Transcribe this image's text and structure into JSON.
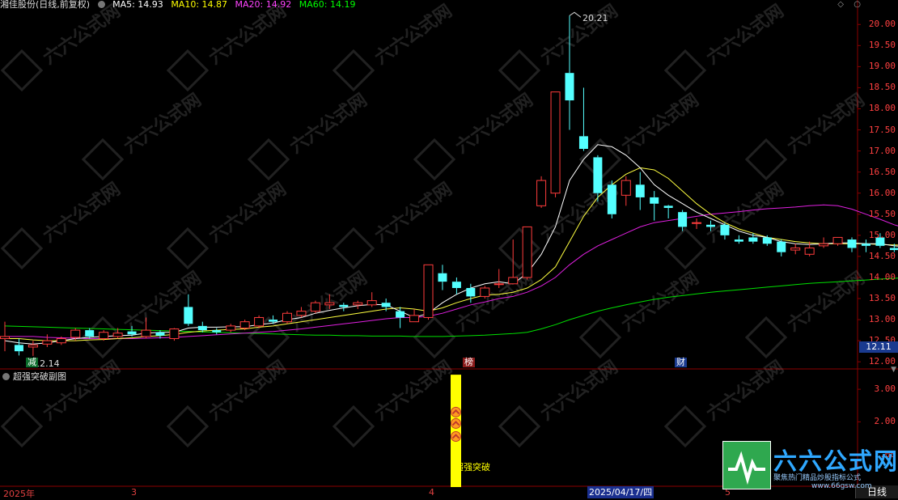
{
  "header": {
    "stock_name": "湘佳股份(日线,前复权)",
    "ma_items": [
      {
        "label": "MA5: 14.93",
        "color": "#ffffff"
      },
      {
        "label": "MA10: 14.87",
        "color": "#ffff00"
      },
      {
        "label": "MA20: 14.92",
        "color": "#ff00ff"
      },
      {
        "label": "MA60: 14.19",
        "color": "#00ff00"
      }
    ]
  },
  "colors": {
    "up": "#ff3c3c",
    "down": "#54ffff",
    "grid": "#8b0000",
    "axis_text": "#ff4040"
  },
  "price_axis": {
    "ticks": [
      "20.00",
      "19.50",
      "19.00",
      "18.50",
      "18.00",
      "17.50",
      "17.00",
      "16.50",
      "16.00",
      "15.50",
      "15.00",
      "14.50",
      "14.00",
      "13.50",
      "13.00",
      "12.50",
      "12.00"
    ]
  },
  "sub_axis": {
    "ticks": [
      "3.00",
      "2.00",
      "1.00"
    ]
  },
  "annotations": {
    "high_label": "20.21",
    "low_label": "12.14",
    "current_price": "12.11",
    "mark_jian": "减",
    "mark_bang": "榜",
    "mark_cai": "财",
    "breakout_label": "超强突破"
  },
  "sub_panel": {
    "title": "超强突破副图"
  },
  "x_axis": {
    "labels": [
      "2025年",
      "3",
      "4",
      "5"
    ],
    "cursor_date": "2025/04/17/四",
    "period": "日线"
  },
  "watermark": {
    "brand": "六六公式网",
    "slogan": "聚焦热门精品炒股指标公式",
    "url": "www.66gsw.com"
  },
  "chart_data": {
    "type": "candlestick",
    "price_range": [
      11.85,
      20.35
    ],
    "candles": [
      [
        12.55,
        12.95,
        12.6,
        12.25
      ],
      [
        12.4,
        12.55,
        12.25,
        12.15
      ],
      [
        12.35,
        12.5,
        12.4,
        12.14
      ],
      [
        12.42,
        12.65,
        12.5,
        12.35
      ],
      [
        12.45,
        12.6,
        12.55,
        12.4
      ],
      [
        12.58,
        12.8,
        12.75,
        12.5
      ],
      [
        12.75,
        12.8,
        12.6,
        12.55
      ],
      [
        12.55,
        12.75,
        12.7,
        12.5
      ],
      [
        12.6,
        12.8,
        12.68,
        12.55
      ],
      [
        12.72,
        12.85,
        12.65,
        12.6
      ],
      [
        12.6,
        13.05,
        12.75,
        12.55
      ],
      [
        12.7,
        12.75,
        12.62,
        12.55
      ],
      [
        12.55,
        12.8,
        12.78,
        12.5
      ],
      [
        13.3,
        13.6,
        12.9,
        12.85
      ],
      [
        12.85,
        12.95,
        12.75,
        12.7
      ],
      [
        12.75,
        12.8,
        12.7,
        12.65
      ],
      [
        12.75,
        12.9,
        12.85,
        12.7
      ],
      [
        12.8,
        13.0,
        12.95,
        12.75
      ],
      [
        12.85,
        13.1,
        13.05,
        12.8
      ],
      [
        13.0,
        13.1,
        12.95,
        12.9
      ],
      [
        12.95,
        13.2,
        13.15,
        12.9
      ],
      [
        13.1,
        13.3,
        13.2,
        13.05
      ],
      [
        13.2,
        13.45,
        13.4,
        13.15
      ],
      [
        13.35,
        13.6,
        13.4,
        13.25
      ],
      [
        13.35,
        13.4,
        13.3,
        13.2
      ],
      [
        13.35,
        13.45,
        13.4,
        13.25
      ],
      [
        13.35,
        13.65,
        13.45,
        13.3
      ],
      [
        13.4,
        13.5,
        13.3,
        13.2
      ],
      [
        13.2,
        13.3,
        13.05,
        12.8
      ],
      [
        12.95,
        13.25,
        13.1,
        12.95
      ],
      [
        13.05,
        14.3,
        14.3,
        13.0
      ],
      [
        14.1,
        14.3,
        13.9,
        13.7
      ],
      [
        13.9,
        14.0,
        13.75,
        13.6
      ],
      [
        13.75,
        13.85,
        13.55,
        13.4
      ],
      [
        13.55,
        13.8,
        13.75,
        13.5
      ],
      [
        13.85,
        14.2,
        13.85,
        13.75
      ],
      [
        13.85,
        14.9,
        14.0,
        13.85
      ],
      [
        14.0,
        15.2,
        15.2,
        13.95
      ],
      [
        15.7,
        16.4,
        16.3,
        15.65
      ],
      [
        16.0,
        18.4,
        18.4,
        15.9
      ],
      [
        18.85,
        20.21,
        18.2,
        17.5
      ],
      [
        17.35,
        18.5,
        17.05,
        17.0
      ],
      [
        16.85,
        16.9,
        16.0,
        15.8
      ],
      [
        16.2,
        16.3,
        15.5,
        15.4
      ],
      [
        15.95,
        16.4,
        16.3,
        15.7
      ],
      [
        16.2,
        16.5,
        15.9,
        15.6
      ],
      [
        15.9,
        16.05,
        15.75,
        15.35
      ],
      [
        15.7,
        15.72,
        15.65,
        15.4
      ],
      [
        15.55,
        15.6,
        15.2,
        15.1
      ],
      [
        15.3,
        15.4,
        15.3,
        15.15
      ],
      [
        15.25,
        15.35,
        15.2,
        15.1
      ],
      [
        15.25,
        15.3,
        15.0,
        14.9
      ],
      [
        14.9,
        15.0,
        14.85,
        14.8
      ],
      [
        14.95,
        15.05,
        14.85,
        14.8
      ],
      [
        14.95,
        15.0,
        14.8,
        14.75
      ],
      [
        14.85,
        14.9,
        14.6,
        14.5
      ],
      [
        14.65,
        14.8,
        14.7,
        14.55
      ],
      [
        14.55,
        14.85,
        14.7,
        14.5
      ],
      [
        14.75,
        14.95,
        14.8,
        14.7
      ],
      [
        14.8,
        14.95,
        14.95,
        14.75
      ],
      [
        14.9,
        14.95,
        14.7,
        14.6
      ],
      [
        14.8,
        14.9,
        14.75,
        14.6
      ],
      [
        14.95,
        15.05,
        14.75,
        14.7
      ],
      [
        14.7,
        14.8,
        14.65,
        14.6
      ],
      [
        14.62,
        14.68,
        14.55,
        14.5
      ],
      [
        14.55,
        14.65,
        14.6,
        14.45
      ],
      [
        14.65,
        14.72,
        14.65,
        14.6
      ],
      [
        14.7,
        15.3,
        15.0,
        14.75
      ],
      [
        15.05,
        15.55,
        15.25,
        14.6
      ],
      [
        14.85,
        14.9,
        14.7,
        14.65
      ],
      [
        15.0,
        16.0,
        15.5,
        15.0
      ]
    ],
    "ma5": [
      12.5,
      12.45,
      12.42,
      12.45,
      12.5,
      12.55,
      12.58,
      12.6,
      12.62,
      12.63,
      12.68,
      12.7,
      12.7,
      12.8,
      12.82,
      12.82,
      12.83,
      12.83,
      12.88,
      12.92,
      13.0,
      13.05,
      13.15,
      13.22,
      13.28,
      13.33,
      13.36,
      13.35,
      13.2,
      13.05,
      13.15,
      13.4,
      13.6,
      13.75,
      13.85,
      13.9,
      13.85,
      14.1,
      14.55,
      15.2,
      16.3,
      16.8,
      17.15,
      17.1,
      16.9,
      16.6,
      16.2,
      15.95,
      15.75,
      15.55,
      15.4,
      15.25,
      15.1,
      15.0,
      14.95,
      14.85,
      14.8,
      14.78,
      14.8,
      14.82,
      14.82,
      14.8,
      14.8,
      14.75,
      14.72,
      14.7,
      14.7,
      14.75,
      14.8,
      14.85,
      14.93
    ],
    "ma10": [
      12.55,
      12.55,
      12.52,
      12.5,
      12.5,
      12.5,
      12.52,
      12.53,
      12.55,
      12.57,
      12.6,
      12.62,
      12.65,
      12.7,
      12.73,
      12.75,
      12.77,
      12.78,
      12.82,
      12.85,
      12.9,
      12.95,
      13.0,
      13.05,
      13.1,
      13.15,
      13.2,
      13.25,
      13.28,
      13.25,
      13.2,
      13.28,
      13.4,
      13.5,
      13.58,
      13.6,
      13.65,
      13.75,
      13.95,
      14.25,
      14.85,
      15.45,
      15.9,
      16.2,
      16.45,
      16.6,
      16.55,
      16.35,
      16.05,
      15.75,
      15.5,
      15.3,
      15.15,
      15.05,
      14.95,
      14.9,
      14.85,
      14.82,
      14.8,
      14.8,
      14.8,
      14.8,
      14.78,
      14.77,
      14.76,
      14.75,
      14.74,
      14.74,
      14.76,
      14.8,
      14.87
    ],
    "ma20": [
      12.6,
      12.6,
      12.6,
      12.58,
      12.57,
      12.56,
      12.55,
      12.55,
      12.55,
      12.55,
      12.56,
      12.57,
      12.58,
      12.6,
      12.62,
      12.64,
      12.66,
      12.68,
      12.7,
      12.72,
      12.75,
      12.78,
      12.82,
      12.86,
      12.9,
      12.94,
      12.98,
      13.02,
      13.05,
      13.05,
      13.08,
      13.15,
      13.25,
      13.35,
      13.42,
      13.5,
      13.55,
      13.65,
      13.8,
      14.0,
      14.3,
      14.55,
      14.75,
      14.9,
      15.05,
      15.2,
      15.3,
      15.35,
      15.4,
      15.45,
      15.5,
      15.53,
      15.56,
      15.6,
      15.63,
      15.65,
      15.67,
      15.7,
      15.72,
      15.7,
      15.62,
      15.5,
      15.38,
      15.25,
      15.15,
      15.05,
      14.98,
      14.93,
      14.9,
      14.9,
      14.92
    ],
    "ma60": [
      12.85,
      12.84,
      12.83,
      12.82,
      12.81,
      12.8,
      12.79,
      12.78,
      12.77,
      12.76,
      12.75,
      12.74,
      12.73,
      12.72,
      12.71,
      12.7,
      12.69,
      12.68,
      12.67,
      12.66,
      12.65,
      12.64,
      12.63,
      12.63,
      12.62,
      12.62,
      12.61,
      12.61,
      12.61,
      12.6,
      12.6,
      12.6,
      12.61,
      12.62,
      12.63,
      12.65,
      12.67,
      12.7,
      12.78,
      12.88,
      13.0,
      13.1,
      13.2,
      13.28,
      13.35,
      13.42,
      13.48,
      13.53,
      13.57,
      13.61,
      13.65,
      13.68,
      13.71,
      13.74,
      13.77,
      13.8,
      13.83,
      13.86,
      13.88,
      13.9,
      13.92,
      13.94,
      13.96,
      13.98,
      14.0,
      14.02,
      14.05,
      14.08,
      14.11,
      14.15,
      14.19
    ],
    "sub_range": [
      0.0,
      3.4
    ],
    "breakout_bar": {
      "index": 31,
      "top": 3.0,
      "bottom": 0.0
    },
    "breakout_arrows": [
      2.3,
      1.95,
      1.55
    ]
  }
}
